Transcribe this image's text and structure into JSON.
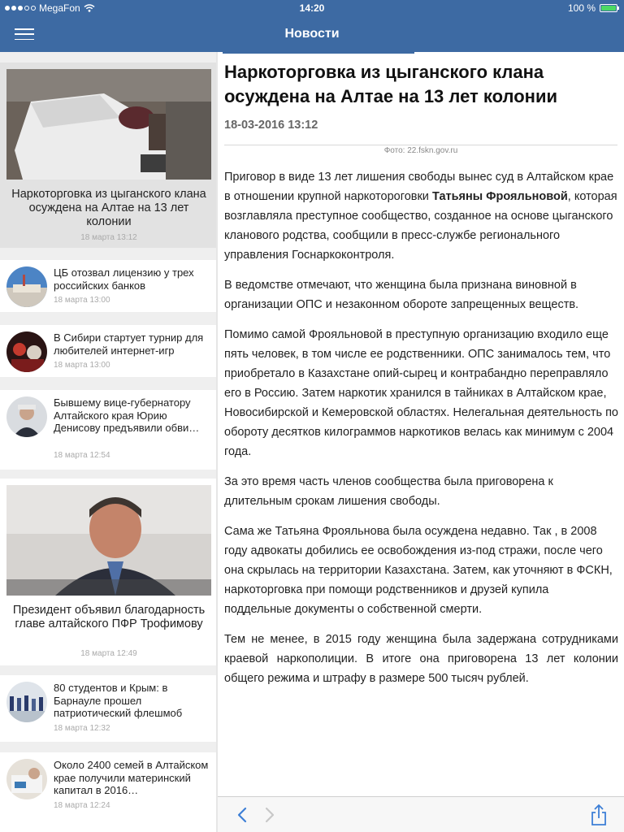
{
  "status": {
    "carrier": "MegaFon",
    "time": "14:20",
    "battery": "100 %"
  },
  "nav": {
    "title": "Новости"
  },
  "sidebar": {
    "featured": [
      {
        "title": "Наркоторговка из цыганского клана осуждена на Алтае на 13 лет колонии",
        "date": "18 марта 13:12"
      },
      {
        "title": "Президент объявил благодарность главе алтайского ПФР Трофимову",
        "date": "18 марта 12:49"
      }
    ],
    "items": [
      {
        "title": "ЦБ отозвал лицензию у трех российских банков",
        "date": "18 марта 13:00"
      },
      {
        "title": "В Сибири стартует турнир для любителей интернет-игр",
        "date": "18 марта 13:00"
      },
      {
        "title": "Бывшему вице-губернатору Алтайского края Юрию Денисову предъявили обви…",
        "date": "18 марта 12:54"
      },
      {
        "title": "80 студентов и Крым: в Барнауле прошел патриотический флешмоб",
        "date": "18 марта 12:32"
      },
      {
        "title": "Около 2400 семей в Алтайском крае получили материнский капитал в 2016…",
        "date": "18 марта 12:24"
      }
    ]
  },
  "article": {
    "title": "Наркоторговка из цыганского клана осуждена на Алтае на 13 лет колонии",
    "date": "18-03-2016 13:12",
    "photo_credit": "Фото: 22.fskn.gov.ru",
    "p1_before": "Приговор в виде 13 лет лишения свободы вынес суд в Алтайском крае в отношении крупной наркотороговки ",
    "p1_bold": "Татьяны Фрояльновой",
    "p1_after": ", которая возглавляла преступное сообщество, созданное на основе цыганского кланового родства, сообщили в пресс-службе регионального управления Госнаркоконтроля.",
    "p2": "В ведомстве отмечают, что женщина была признана виновной в организации ОПС и незаконном обороте запрещенных веществ.",
    "p3": "Помимо самой Фрояльновой в преступную организацию входило еще пять человек, в том числе ее родственники. ОПС занималось тем, что приобретало в Казахстане опий-сырец и контрабандно переправляло его в Россию. Затем наркотик хранился в тайниках в Алтайском крае, Новосибирской и Кемеровской областях. Нелегальная деятельность по обороту десятков килограммов наркотиков велась как минимум с 2004 года.",
    "p4": "За это время часть членов сообщества была приговорена к длительным срокам лишения свободы.",
    "p5": "Сама же Татьяна Фрояльнова была осуждена недавно. Так , в 2008 году адвокаты добились ее освобождения из-под стражи, после чего она скрылась на территории Казахстана. Затем, как уточняют в ФСКН, наркоторговка при помощи родственников и друзей купила поддельные документы о собственной смерти.",
    "p6": "Тем не менее, в 2015 году женщина была задержана сотрудниками краевой наркополиции. В итоге она приговорена 13 лет колонии общего режима и штрафу в размере 500 тысяч рублей."
  },
  "icons": {
    "menu": "hamburger-icon",
    "wifi": "wifi-icon",
    "battery": "battery-icon",
    "back": "chevron-left-icon",
    "forward": "chevron-right-icon",
    "share": "share-icon"
  },
  "colors": {
    "nav": "#3d6aa3",
    "toolbar_tint": "#3d7fd6"
  }
}
